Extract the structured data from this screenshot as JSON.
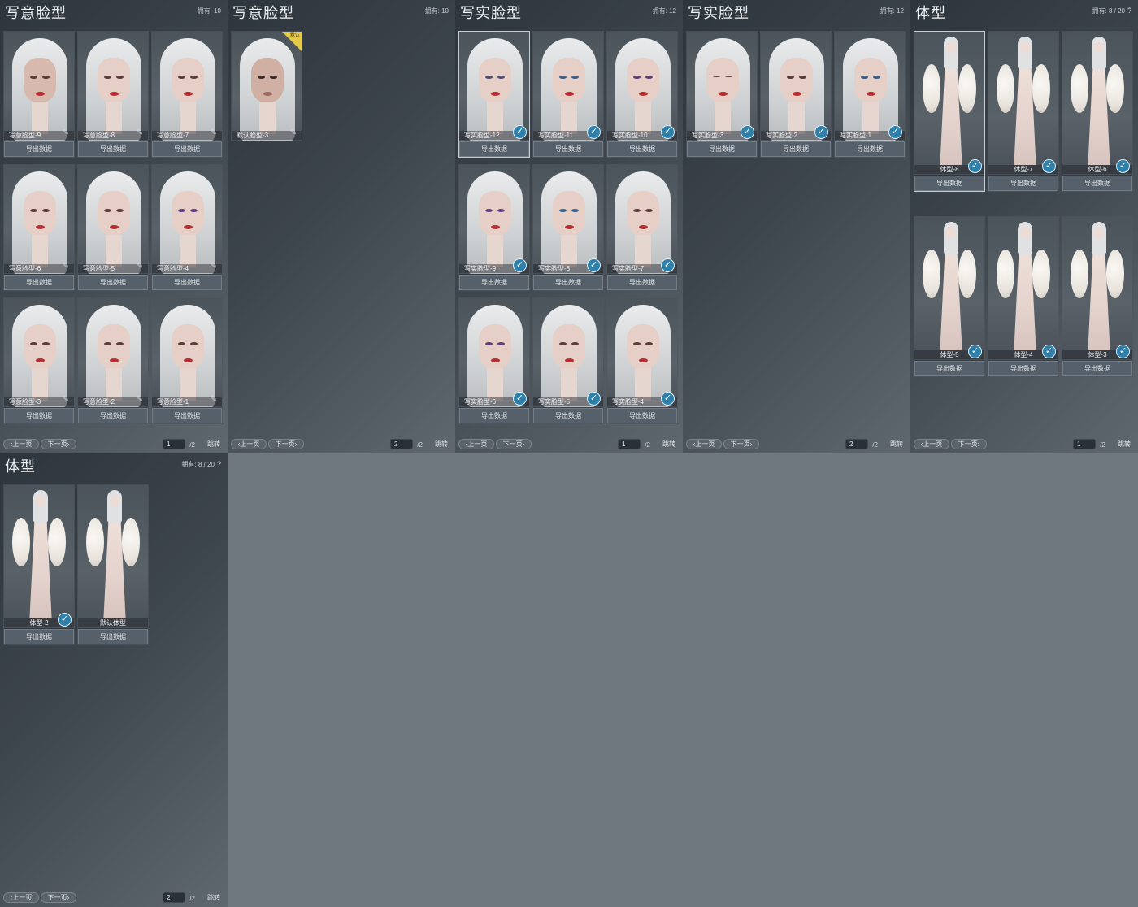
{
  "panels": [
    {
      "title": "写意脸型",
      "owned_text": "拥有: 10",
      "cards": [
        {
          "label": "写意脸型-9",
          "export": "导出数据"
        },
        {
          "label": "写意脸型-8",
          "export": "导出数据"
        },
        {
          "label": "写意脸型-7",
          "export": "导出数据"
        },
        {
          "label": "写意脸型-6",
          "export": "导出数据"
        },
        {
          "label": "写意脸型-5",
          "export": "导出数据"
        },
        {
          "label": "写意脸型-4",
          "export": "导出数据"
        },
        {
          "label": "写意脸型-3",
          "export": "导出数据"
        },
        {
          "label": "写意脸型-2",
          "export": "导出数据"
        },
        {
          "label": "写意脸型-1",
          "export": "导出数据"
        }
      ],
      "pager": {
        "prev": "上一页",
        "next": "下一页",
        "page": "1",
        "total": "/2",
        "jump": "跳转"
      }
    },
    {
      "title": "写意脸型",
      "owned_text": "拥有: 10",
      "cards": [
        {
          "label": "默认脸型-3",
          "badge": "默认"
        }
      ],
      "pager": {
        "prev": "上一页",
        "next": "下一页",
        "page": "2",
        "total": "/2",
        "jump": "跳转"
      }
    },
    {
      "title": "写实脸型",
      "owned_text": "拥有: 12",
      "cards": [
        {
          "label": "写实脸型-12",
          "export": "导出数据"
        },
        {
          "label": "写实脸型-11",
          "export": "导出数据"
        },
        {
          "label": "写实脸型-10",
          "export": "导出数据"
        },
        {
          "label": "写实脸型-9",
          "export": "导出数据"
        },
        {
          "label": "写实脸型-8",
          "export": "导出数据"
        },
        {
          "label": "写实脸型-7",
          "export": "导出数据"
        },
        {
          "label": "写实脸型-6",
          "export": "导出数据"
        },
        {
          "label": "写实脸型-5",
          "export": "导出数据"
        },
        {
          "label": "写实脸型-4",
          "export": "导出数据"
        }
      ],
      "pager": {
        "prev": "上一页",
        "next": "下一页",
        "page": "1",
        "total": "/2",
        "jump": "跳转"
      }
    },
    {
      "title": "写实脸型",
      "owned_text": "拥有: 12",
      "cards": [
        {
          "label": "写实脸型-3",
          "export": "导出数据"
        },
        {
          "label": "写实脸型-2",
          "export": "导出数据"
        },
        {
          "label": "写实脸型-1",
          "export": "导出数据"
        }
      ],
      "pager": {
        "prev": "上一页",
        "next": "下一页",
        "page": "2",
        "total": "/2",
        "jump": "跳转"
      }
    },
    {
      "title": "体型",
      "owned_text": "拥有: 8 / 20",
      "help": "?",
      "cards": [
        {
          "label": "体型-8",
          "export": "导出数据"
        },
        {
          "label": "体型-7",
          "export": "导出数据"
        },
        {
          "label": "体型-6",
          "export": "导出数据"
        },
        {
          "label": "体型-5",
          "export": "导出数据"
        },
        {
          "label": "体型-4",
          "export": "导出数据"
        },
        {
          "label": "体型-3",
          "export": "导出数据"
        }
      ],
      "pager": {
        "prev": "上一页",
        "next": "下一页",
        "page": "1",
        "total": "/2",
        "jump": "跳转"
      }
    },
    {
      "title": "体型",
      "owned_text": "拥有: 8 / 20",
      "help": "?",
      "cards": [
        {
          "label": "体型-2",
          "export": "导出数据"
        },
        {
          "label": "默认体型",
          "export": "导出数据"
        }
      ],
      "pager": {
        "prev": "上一页",
        "next": "下一页",
        "page": "2",
        "total": "/2",
        "jump": "跳转"
      }
    }
  ],
  "icons": {
    "edit": "pencil-icon",
    "selected": "check-icon"
  },
  "colors": {
    "check": "#2e7fa9",
    "badge": "#e7c94a"
  }
}
